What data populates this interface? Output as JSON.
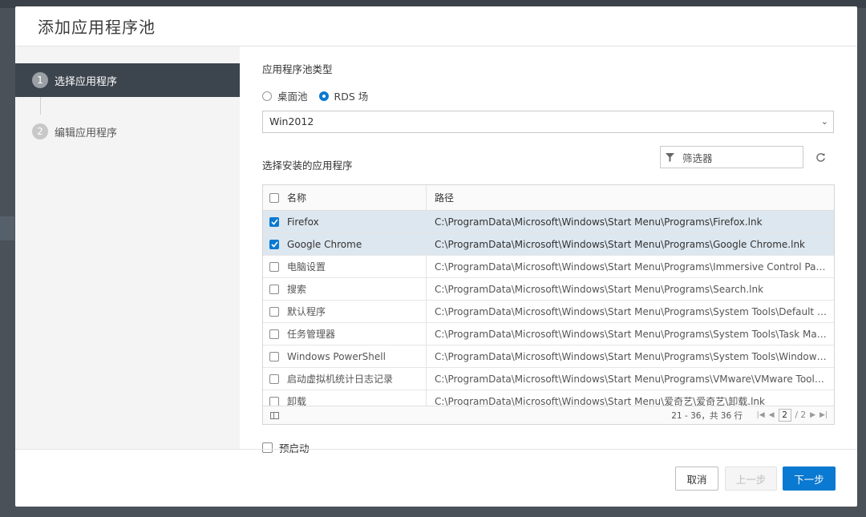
{
  "dialog": {
    "title": "添加应用程序池"
  },
  "wizard": {
    "steps": [
      {
        "num": "1",
        "label": "选择应用程序"
      },
      {
        "num": "2",
        "label": "编辑应用程序"
      }
    ]
  },
  "pool_type": {
    "label": "应用程序池类型",
    "options": [
      "桌面池",
      "RDS 场"
    ],
    "selected": "RDS 场"
  },
  "farm_select": {
    "value": "Win2012"
  },
  "apps": {
    "label": "选择安装的应用程序",
    "filter_placeholder": "筛选器",
    "columns": {
      "name": "名称",
      "path": "路径"
    },
    "rows": [
      {
        "name": "Firefox",
        "path": "C:\\ProgramData\\Microsoft\\Windows\\Start Menu\\Programs\\Firefox.lnk",
        "checked": true
      },
      {
        "name": "Google Chrome",
        "path": "C:\\ProgramData\\Microsoft\\Windows\\Start Menu\\Programs\\Google Chrome.lnk",
        "checked": true
      },
      {
        "name": "电脑设置",
        "path": "C:\\ProgramData\\Microsoft\\Windows\\Start Menu\\Programs\\Immersive Control Panel.lnk",
        "checked": false
      },
      {
        "name": "搜索",
        "path": "C:\\ProgramData\\Microsoft\\Windows\\Start Menu\\Programs\\Search.lnk",
        "checked": false
      },
      {
        "name": "默认程序",
        "path": "C:\\ProgramData\\Microsoft\\Windows\\Start Menu\\Programs\\System Tools\\Default Programs....",
        "checked": false
      },
      {
        "name": "任务管理器",
        "path": "C:\\ProgramData\\Microsoft\\Windows\\Start Menu\\Programs\\System Tools\\Task Manager.lnk",
        "checked": false
      },
      {
        "name": "Windows PowerShell",
        "path": "C:\\ProgramData\\Microsoft\\Windows\\Start Menu\\Programs\\System Tools\\Windows PowerSh...",
        "checked": false
      },
      {
        "name": "启动虚拟机统计日志记录",
        "path": "C:\\ProgramData\\Microsoft\\Windows\\Start Menu\\Programs\\VMware\\VMware Tools\\启动虚拟...",
        "checked": false
      },
      {
        "name": "卸载",
        "path": "C:\\ProgramData\\Microsoft\\Windows\\Start Menu\\爱奇艺\\爱奇艺\\卸载.lnk",
        "checked": false
      }
    ],
    "pager": {
      "range": "21 - 36，共 36 行",
      "current_page": "2",
      "total_pages": "/ 2"
    }
  },
  "prelaunch": {
    "label": "预启动"
  },
  "buttons": {
    "cancel": "取消",
    "prev": "上一步",
    "next": "下一步"
  },
  "colors": {
    "accent": "#0a79d1",
    "nav_active": "#3c444d",
    "selected_row": "#dde7ef"
  }
}
